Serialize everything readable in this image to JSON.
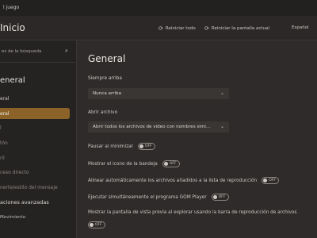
{
  "titlebar": {
    "title": "l juego"
  },
  "topbar": {
    "home_label": "Inicio",
    "reset_all_label": "Reiniciar todo",
    "reset_screen_label": "Reiniciar la pantalla actual",
    "language_label": "Español"
  },
  "sidebar": {
    "search_placeholder": "es de la búsqueda",
    "title": "eneral",
    "items": [
      {
        "label": "eral"
      },
      {
        "label": "eral"
      },
      {
        "label": "l"
      },
      {
        "label": "tón"
      },
      {
        "label": "ril"
      },
      {
        "label": "ceso directo"
      },
      {
        "label": "nerte/estilo del mensaje"
      }
    ],
    "section_advanced": "aciones avanzadas",
    "section_bottom": "Movimiento"
  },
  "main": {
    "title": "General",
    "always_on_top": {
      "label": "Siempre arriba",
      "value": "Nunca arriba"
    },
    "open_file": {
      "label": "Abrir archivo",
      "value": "Abrir todos los archivos de video con nombres simi..."
    },
    "toggles": [
      {
        "label": "Pausar al minimizar",
        "state": "OFF"
      },
      {
        "label": "Mostrar el icono de la bandeja",
        "state": "OFF"
      },
      {
        "label": "Alinear automáticamente los archivos añadidos a la lista de reproducción",
        "state": "OFF"
      },
      {
        "label": "Ejecutar simultáneamente el programa GOM Player",
        "state": "OFF"
      },
      {
        "label": "Mostrar la pantalla de vista previa al explorar usando la barra de reproducción de archivos",
        "state": "OFF"
      }
    ]
  },
  "icons": {
    "reset_all": "refresh-icon",
    "reset_screen": "refresh-icon",
    "search": "search-icon",
    "dropdown": "chevron-down-icon"
  },
  "colors": {
    "accent": "#8b6328",
    "background": "#2e2b2a",
    "sidebar": "#252322"
  }
}
